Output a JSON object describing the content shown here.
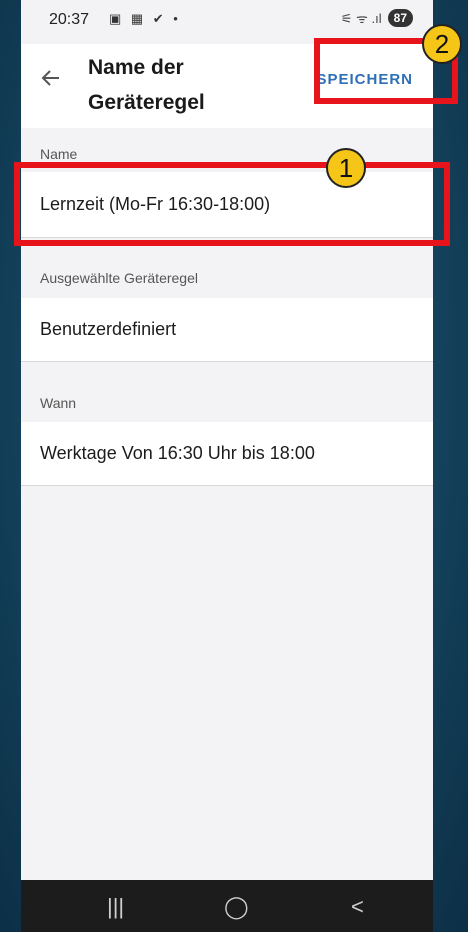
{
  "status_bar": {
    "time": "20:37",
    "left_icons": "▣ ▦ ✔ •",
    "signal_icons": "⚟ ᯤ .ıl",
    "battery": "87"
  },
  "app_bar": {
    "title_line1": "Name der",
    "title_line2": "Geräteregel",
    "save_label": "SPEICHERN"
  },
  "fields": [
    {
      "label": "Name",
      "value": "Lernzeit (Mo-Fr 16:30-18:00)"
    },
    {
      "label": "Ausgewählte Geräteregel",
      "value": "Benutzerdefiniert"
    },
    {
      "label": "Wann",
      "value": "Werktage Von 16:30 Uhr bis 18:00"
    }
  ],
  "annotations": {
    "badge_1": "1",
    "badge_2": "2",
    "highlight_color": "#e8141b",
    "badge_color": "#f5c518"
  },
  "nav_bar": {
    "recent": "|||",
    "home": "◯",
    "back": "<"
  },
  "colors": {
    "accent": "#2f6fb5",
    "background": "#f3f3f5"
  }
}
